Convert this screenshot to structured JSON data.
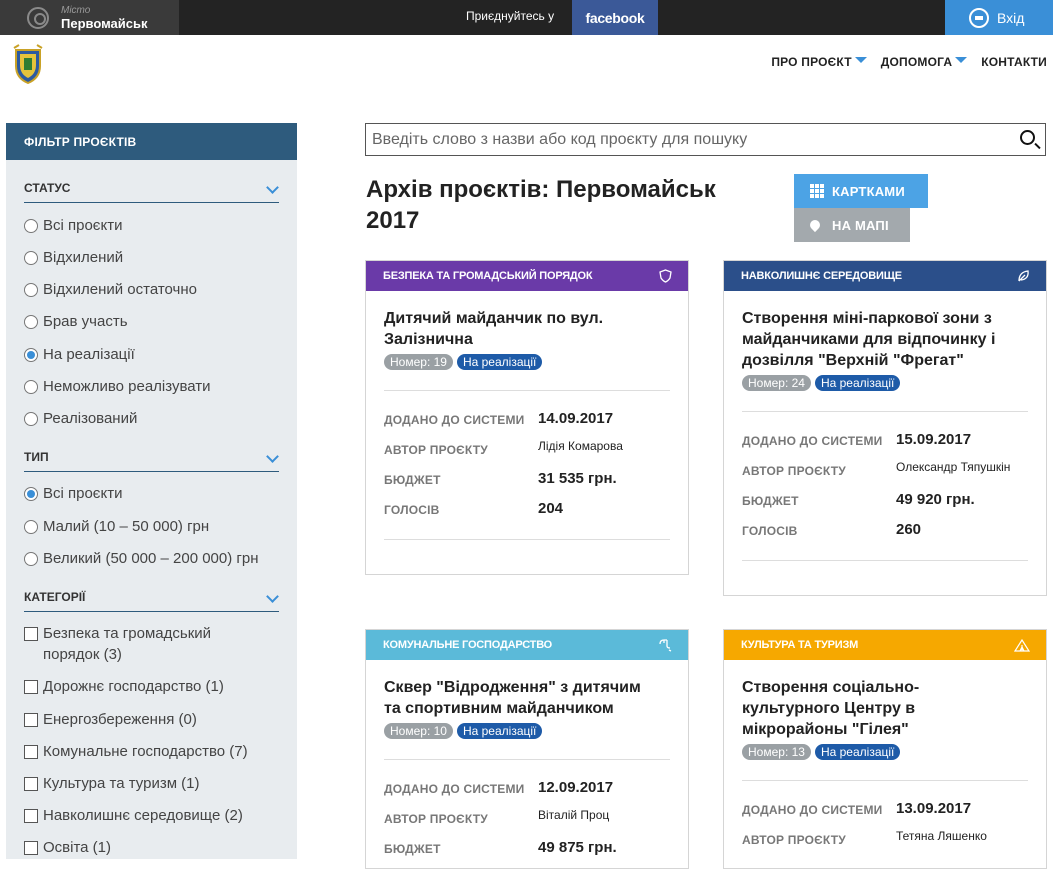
{
  "topbar": {
    "city_caption": "Місто",
    "city_name": "Первомайськ",
    "join_text": "Приєднуйтесь у",
    "facebook_label": "facebook",
    "login_label": "Вхід"
  },
  "nav": {
    "about": "ПРО ПРОЄКТ",
    "help": "ДОПОМОГА",
    "contacts": "КОНТАКТИ"
  },
  "sidebar": {
    "title": "ФІЛЬТР ПРОЄКТІВ",
    "status_title": "СТАТУС",
    "status_options": [
      "Всі проєкти",
      "Відхилений",
      "Відхилений остаточно",
      "Брав участь",
      "На реалізації",
      "Неможливо реалізувати",
      "Реалізований"
    ],
    "status_selected": "На реалізації",
    "type_title": "ТИП",
    "type_options": [
      "Всі проєкти",
      "Малий (10 – 50 000) грн",
      "Великий (50 000 – 200 000) грн"
    ],
    "type_selected": "Всі проєкти",
    "categories_title": "КАТЕГОРІЇ",
    "categories": [
      "Безпека та громадський порядок (3)",
      "Дорожнє господарство (1)",
      "Енергозбереження (0)",
      "Комунальне господарство (7)",
      "Культура та туризм (1)",
      "Навколишнє середовище (2)",
      "Освіта (1)"
    ]
  },
  "search": {
    "placeholder": "Введіть слово з назви або код проєкту для пошуку"
  },
  "main": {
    "title_line1": "Архів проєктів: Первомайськ",
    "title_line2": "2017",
    "view_cards": "КАРТКАМИ",
    "view_map": "НА МАПІ"
  },
  "labels": {
    "added": "ДОДАНО ДО СИСТЕМИ",
    "author": "АВТОР ПРОЄКТУ",
    "budget": "БЮДЖЕТ",
    "votes": "ГОЛОСІВ"
  },
  "cards": [
    {
      "category": "БЕЗПЕКА ТА ГРОМАДСЬКИЙ ПОРЯДОК",
      "color": "#6a3aa8",
      "icon": "shield-icon",
      "title1": "Дитячий майданчик по вул.",
      "title2": "Залізнична",
      "title3": "",
      "number": "Номер: 19",
      "status": "На реалізації",
      "added": "14.09.2017",
      "author": "Лідія Комарова",
      "budget": "31 535 грн.",
      "votes": "204"
    },
    {
      "category": "НАВКОЛИШНЄ СЕРЕДОВИЩЕ",
      "color": "#2b4f8a",
      "icon": "leaf-icon",
      "title1": "Створення міні-паркової зони з",
      "title2": "майданчиками для відпочинку і",
      "title3": "дозвілля \"Верхній \"Фрегат\"",
      "number": "Номер: 24",
      "status": "На реалізації",
      "added": "15.09.2017",
      "author": "Олександр Тяпушкін",
      "budget": "49 920 грн.",
      "votes": "260"
    },
    {
      "category": "КОМУНАЛЬНЕ ГОСПОДАРСТВО",
      "color": "#5bbad9",
      "icon": "tap-icon",
      "title1": "Сквер \"Відродження\" з дитячим",
      "title2": "та спортивним майданчиком",
      "title3": "",
      "number": "Номер: 10",
      "status": "На реалізації",
      "added": "12.09.2017",
      "author": "Віталій Проц",
      "budget": "49 875 грн.",
      "votes": ""
    },
    {
      "category": "КУЛЬТУРА ТА ТУРИЗМ",
      "color": "#f6a800",
      "icon": "tent-icon",
      "title1": "Створення соціально-",
      "title2": "культурного Центру в",
      "title3": "мікрорайоны \"Гілея\"",
      "number": "Номер: 13",
      "status": "На реалізації",
      "added": "13.09.2017",
      "author": "Тетяна Ляшенко",
      "budget": "",
      "votes": ""
    }
  ]
}
